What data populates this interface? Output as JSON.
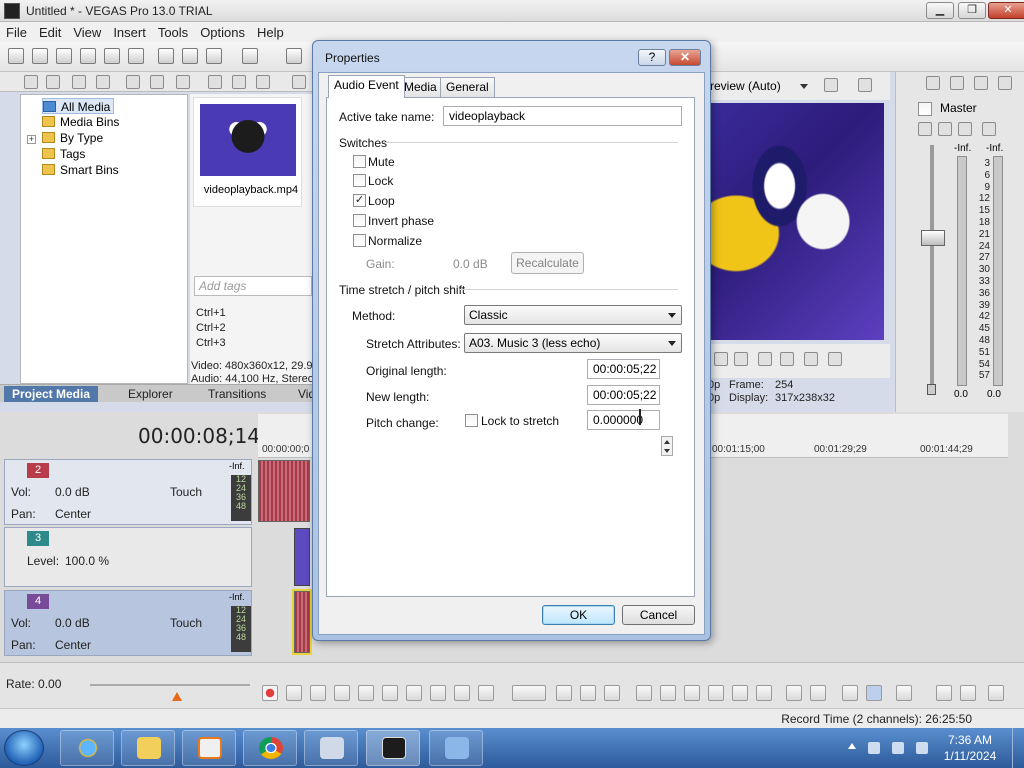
{
  "window": {
    "title": "Untitled * - VEGAS Pro 13.0 TRIAL",
    "minimize": "▁",
    "maximize": "❐",
    "close": "✕"
  },
  "menu": [
    "File",
    "Edit",
    "View",
    "Insert",
    "Tools",
    "Options",
    "Help"
  ],
  "media_tree": {
    "items": [
      "All Media",
      "Media Bins",
      "By Type",
      "Tags",
      "Smart Bins"
    ],
    "expander": "+"
  },
  "media": {
    "thumbnail_label": "videoplayback.mp4",
    "tags_placeholder": "Add tags",
    "shortcuts": [
      "Ctrl+1",
      "Ctrl+2",
      "Ctrl+3"
    ],
    "info_video": "Video: 480x360x12, 29.9",
    "info_audio": "Audio: 44,100 Hz, Stereo"
  },
  "panel_tabs": [
    "Project Media",
    "Explorer",
    "Transitions",
    "Vid"
  ],
  "preview": {
    "mode": "review (Auto)",
    "frame_label": "Frame:",
    "frame_value": "254",
    "display_label": "Display:",
    "display_value": "317x238x32",
    "left_clip1": "0p",
    "left_clip2": "0p"
  },
  "master": {
    "title": "Master",
    "inf_left": "-Inf.",
    "inf_right": "-Inf.",
    "scale": [
      "3",
      "6",
      "9",
      "12",
      "15",
      "18",
      "21",
      "24",
      "27",
      "30",
      "33",
      "36",
      "39",
      "42",
      "45",
      "48",
      "51",
      "54",
      "57"
    ],
    "level_left": "0.0",
    "level_right": "0.0"
  },
  "timeline": {
    "time": "00:00:08;14",
    "ruler": [
      "00:00:00;0",
      "00:01:15;00",
      "00:01:29;29",
      "00:01:44;29"
    ],
    "tracks": [
      {
        "num": "2",
        "vol_label": "Vol:",
        "vol": "0.0 dB",
        "pan_label": "Pan:",
        "pan": "Center",
        "mode": "Touch",
        "inf": "-Inf.",
        "meter": [
          "12",
          "24",
          "36",
          "48"
        ]
      },
      {
        "num": "3",
        "level_label": "Level:",
        "level": "100.0 %"
      },
      {
        "num": "4",
        "vol_label": "Vol:",
        "vol": "0.0 dB",
        "pan_label": "Pan:",
        "pan": "Center",
        "mode": "Touch",
        "inf": "-Inf.",
        "meter": [
          "12",
          "24",
          "36",
          "48"
        ]
      }
    ],
    "rate": "Rate: 0.00"
  },
  "status": {
    "record_time": "Record Time (2 channels): 26:25:50"
  },
  "taskbar": {
    "time": "7:36 AM",
    "date": "1/11/2024"
  },
  "dialog": {
    "title": "Properties",
    "help": "?",
    "close": "✕",
    "tabs": [
      "Audio Event",
      "Media",
      "General"
    ],
    "active_take_label": "Active take name:",
    "active_take_value": "videoplayback",
    "switches_label": "Switches",
    "switches": [
      {
        "label": "Mute",
        "checked": false
      },
      {
        "label": "Lock",
        "checked": false
      },
      {
        "label": "Loop",
        "checked": true
      },
      {
        "label": "Invert phase",
        "checked": false
      },
      {
        "label": "Normalize",
        "checked": false
      }
    ],
    "check_mark": "✓",
    "gain_label": "Gain:",
    "gain_value": "0.0 dB",
    "recalculate": "Recalculate",
    "time_stretch_label": "Time stretch / pitch shift",
    "method_label": "Method:",
    "method_value": "Classic",
    "stretch_label": "Stretch Attributes:",
    "stretch_value": "A03. Music 3 (less echo)",
    "original_length_label": "Original length:",
    "original_length_value": "00:00:05;22",
    "new_length_label": "New length:",
    "new_length_value": "00:00:05;22",
    "pitch_label": "Pitch change:",
    "lock_to_stretch": "Lock to stretch",
    "pitch_value": "0.000000",
    "ok": "OK",
    "cancel": "Cancel"
  }
}
